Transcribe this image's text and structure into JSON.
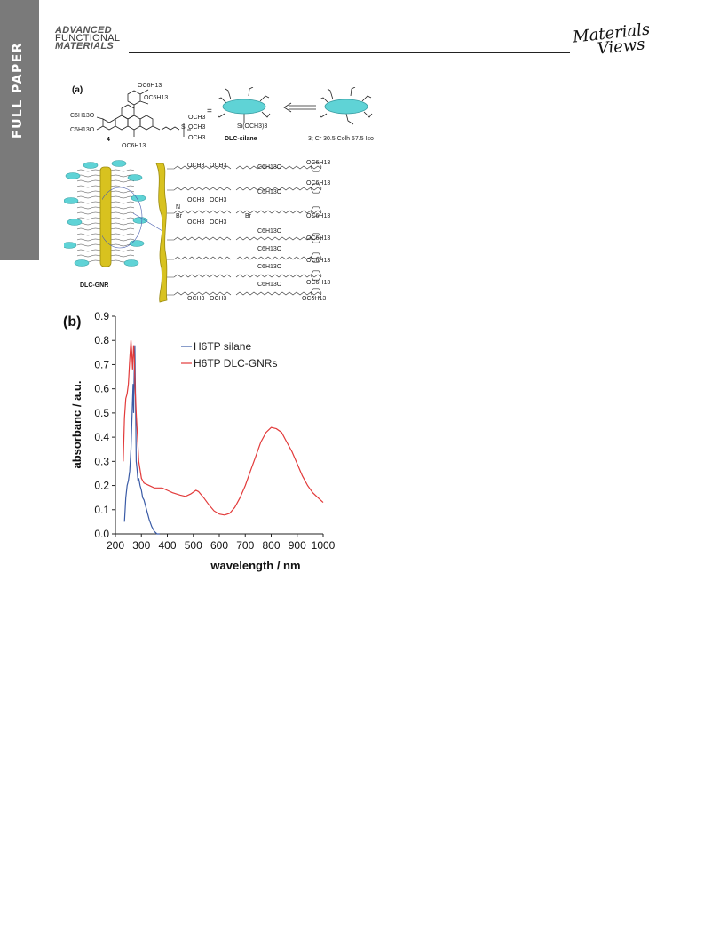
{
  "sidebar": {
    "label": "FULL PAPER"
  },
  "header": {
    "journal_lines": [
      "ADVANCED",
      "FUNCTIONAL",
      "MATERIALS"
    ],
    "brand_lines": [
      "Materials",
      "Views"
    ]
  },
  "figure": {
    "panel_a": {
      "label": "(a)",
      "compound_4": "4",
      "dlc_silane_label": "DLC-silane",
      "compound_3_label": "3; Cr 30.5 Colh 57.5 Iso",
      "dlc_gnr_label": "DLC-GNR",
      "equals": "=",
      "si_group": "Si(OCH3)3",
      "och3": "OCH3",
      "oc6h13": "OC6H13",
      "c6h13o": "C6H13O",
      "si": "Si",
      "o": "O",
      "s": "S",
      "n": "N",
      "br": "Br"
    },
    "panel_b": {
      "label": "(b)"
    }
  },
  "chart_data": {
    "type": "line",
    "xlabel": "wavelength / nm",
    "ylabel": "absorbanc / a.u.",
    "xlim": [
      200,
      1000
    ],
    "ylim": [
      0.0,
      0.9
    ],
    "xticks": [
      "200",
      "300",
      "400",
      "500",
      "600",
      "700",
      "800",
      "900",
      "1000"
    ],
    "yticks": [
      "0.0",
      "0.1",
      "0.2",
      "0.3",
      "0.4",
      "0.5",
      "0.6",
      "0.7",
      "0.8",
      "0.9"
    ],
    "legend_position": "top-left",
    "grid": false,
    "series": [
      {
        "name": "H6TP silane",
        "color": "#3a5ba6",
        "x": [
          235,
          240,
          245,
          250,
          255,
          260,
          265,
          268,
          270,
          272,
          275,
          278,
          280,
          283,
          287,
          290,
          295,
          300,
          305,
          310,
          320,
          330,
          340,
          350,
          360,
          370
        ],
        "y": [
          0.05,
          0.15,
          0.2,
          0.22,
          0.26,
          0.35,
          0.52,
          0.62,
          0.5,
          0.66,
          0.78,
          0.5,
          0.3,
          0.27,
          0.22,
          0.23,
          0.2,
          0.18,
          0.15,
          0.14,
          0.1,
          0.06,
          0.03,
          0.01,
          0.0,
          0.0
        ]
      },
      {
        "name": "H6TP DLC-GNRs",
        "color": "#e23a3a",
        "x": [
          230,
          235,
          240,
          245,
          250,
          255,
          260,
          263,
          266,
          270,
          273,
          276,
          280,
          285,
          290,
          300,
          310,
          330,
          350,
          380,
          400,
          420,
          450,
          470,
          490,
          510,
          520,
          540,
          560,
          580,
          600,
          620,
          640,
          660,
          680,
          700,
          720,
          740,
          760,
          780,
          800,
          820,
          840,
          860,
          880,
          900,
          920,
          940,
          960,
          980,
          1000
        ],
        "y": [
          0.3,
          0.48,
          0.56,
          0.58,
          0.62,
          0.72,
          0.8,
          0.75,
          0.68,
          0.78,
          0.72,
          0.6,
          0.5,
          0.4,
          0.3,
          0.23,
          0.21,
          0.2,
          0.19,
          0.19,
          0.18,
          0.17,
          0.16,
          0.155,
          0.165,
          0.18,
          0.175,
          0.15,
          0.12,
          0.095,
          0.082,
          0.078,
          0.085,
          0.11,
          0.15,
          0.2,
          0.26,
          0.32,
          0.38,
          0.42,
          0.44,
          0.435,
          0.42,
          0.38,
          0.34,
          0.29,
          0.24,
          0.2,
          0.17,
          0.15,
          0.13
        ]
      }
    ]
  }
}
